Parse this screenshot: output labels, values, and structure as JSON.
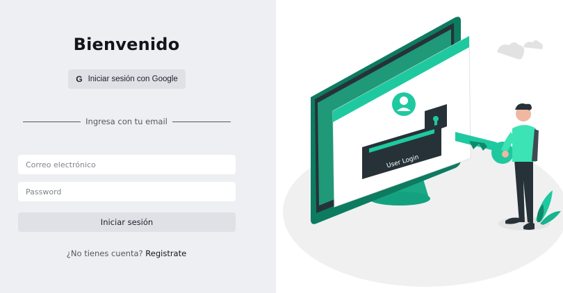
{
  "login": {
    "title": "Bienvenido",
    "google_button_icon": "G",
    "google_button_label": "Iniciar sesión con Google",
    "divider_text": "Ingresa con tu email",
    "email_placeholder": "Correo electrónico",
    "password_placeholder": "Password",
    "submit_label": "Iniciar sesión",
    "signup_prompt": "¿No tienes cuenta?",
    "signup_link": "Registrate"
  },
  "illustration": {
    "screen_label": "User Login",
    "accent_color": "#1fc9a0",
    "accent_dark": "#0e8a6b"
  }
}
